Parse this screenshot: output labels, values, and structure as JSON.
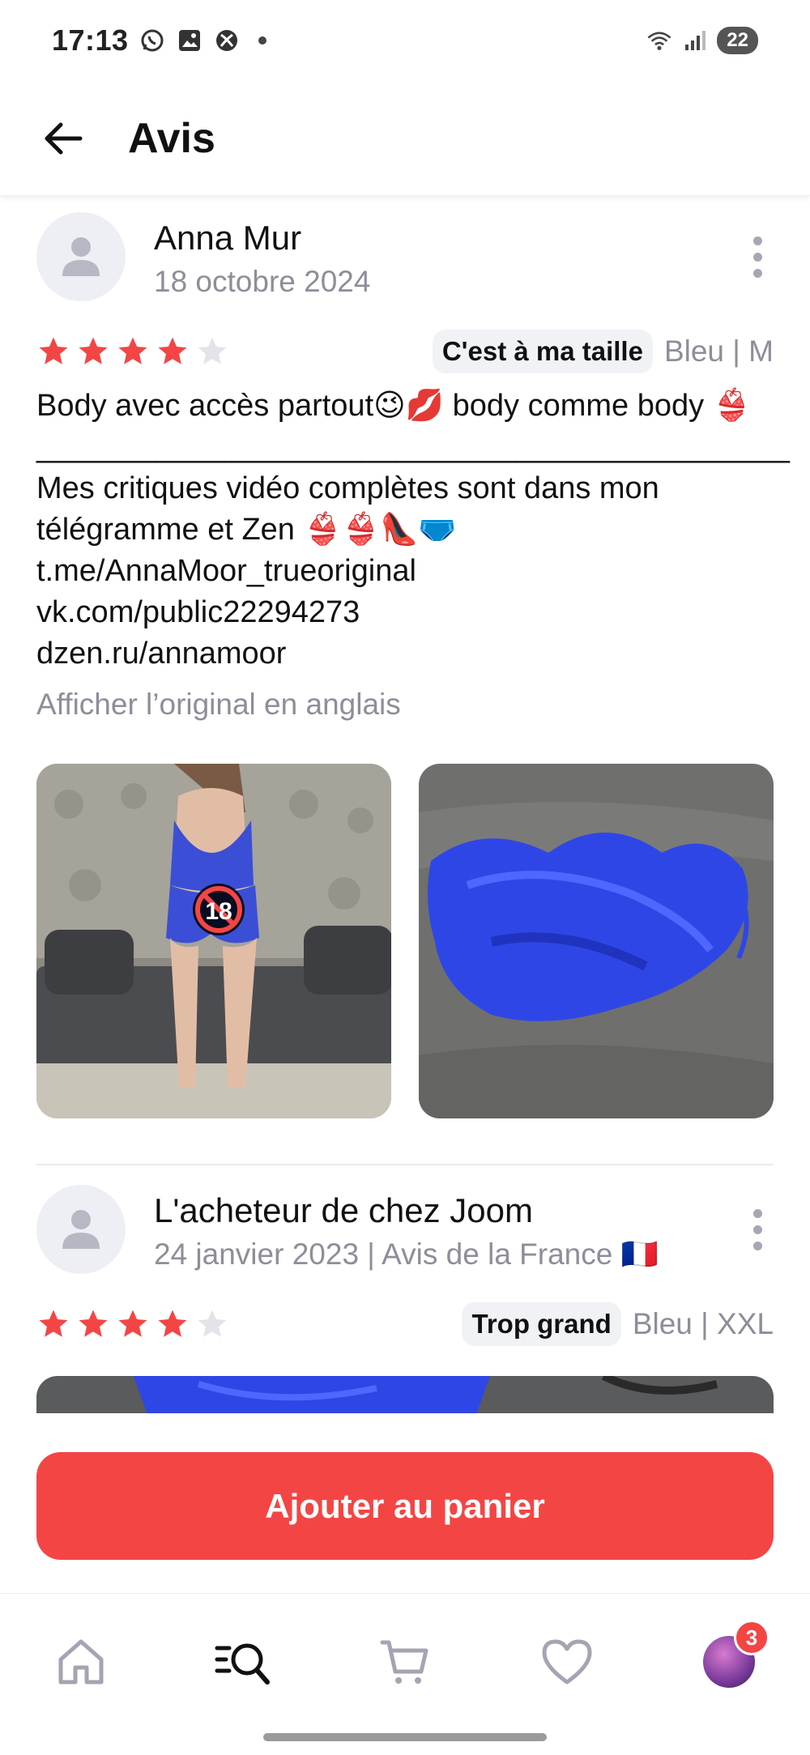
{
  "status_bar": {
    "time": "17:13",
    "battery": "22"
  },
  "header": {
    "title": "Avis"
  },
  "reviews": [
    {
      "author": "Anna Mur",
      "date": "18 octobre 2024",
      "rating": 4,
      "fit": "C'est à ma taille",
      "variant": "Bleu | M",
      "text": "Body avec accès partout😉💋 body comme body 👙\n____________________________________________\nMes critiques vidéo complètes sont dans mon télégramme et Zen 👙👙👠🩲\nt.me/AnnaMoor_trueoriginal\nvk.com/public22294273\ndzen.ru/annamoor",
      "translate_link": "Afficher l’original en anglais",
      "age_badge": "18"
    },
    {
      "author": "L'acheteur de chez Joom",
      "date": "24 janvier 2023 | Avis de la France 🇫🇷",
      "rating": 4,
      "fit": "Trop grand",
      "variant": "Bleu | XXL"
    }
  ],
  "cart": {
    "button_label": "Ajouter au panier"
  },
  "bottom_nav": {
    "profile_badge": "3"
  },
  "colors": {
    "accent": "#f44545",
    "star_on": "#f44545",
    "star_off": "#e3e4ea",
    "muted_text": "#8e8e9a"
  }
}
